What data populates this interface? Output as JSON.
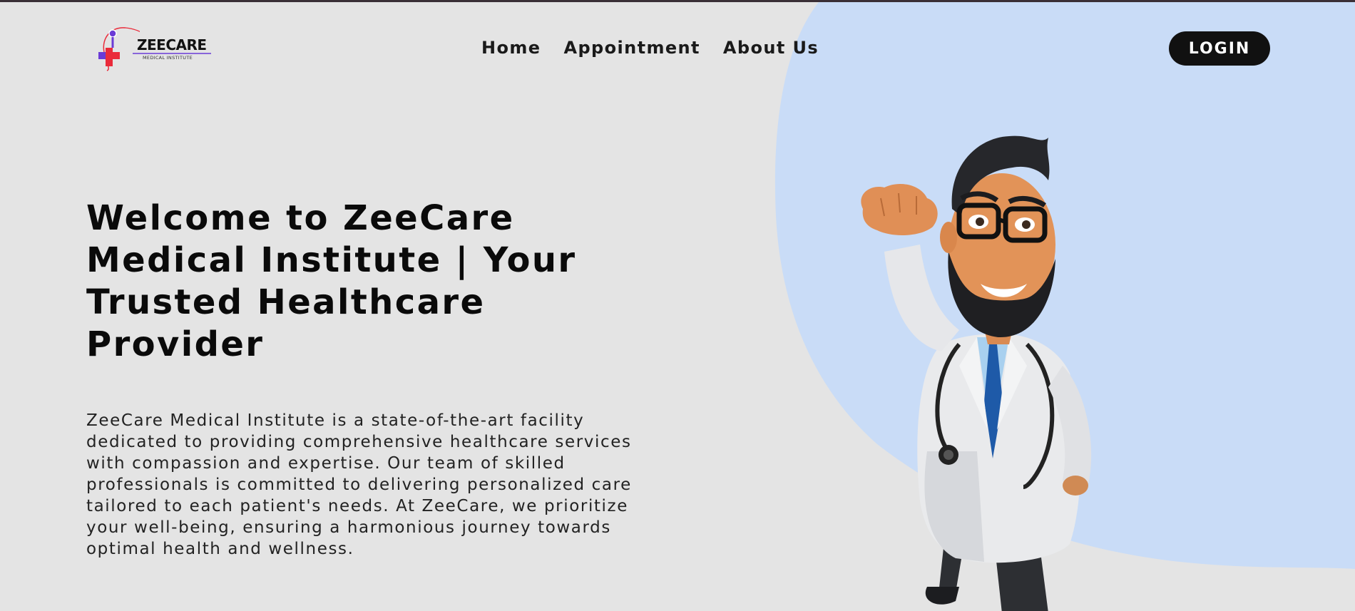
{
  "header": {
    "logo": {
      "name": "ZEECARE",
      "subtitle": "MEDICAL INSTITUTE"
    },
    "nav": {
      "home": "Home",
      "appointment": "Appointment",
      "about": "About Us"
    },
    "login_label": "LOGIN"
  },
  "hero": {
    "title": "Welcome to ZeeCare Medical Institute | Your Trusted Healthcare Provider",
    "description": "ZeeCare Medical Institute is a state-of-the-art facility dedicated to providing comprehensive healthcare services with compassion and expertise. Our team of skilled professionals is committed to delivering personalized care tailored to each patient's needs. At ZeeCare, we prioritize your well-being, ensuring a harmonious journey towards optimal health and wellness.",
    "image_icon": "doctor-illustration"
  },
  "colors": {
    "background": "#e4e4e4",
    "blob": "#c9dcf7",
    "button": "#111111",
    "logo_red": "#ea2b3a",
    "logo_purple": "#6a3bd6"
  }
}
